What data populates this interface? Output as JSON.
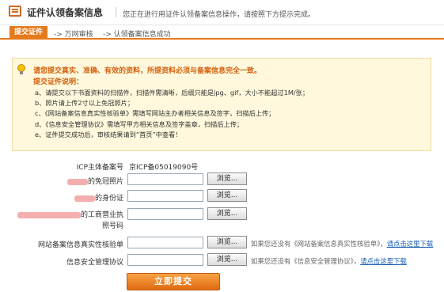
{
  "header": {
    "title": "证件认领备案信息",
    "description": "您正在进行用证件认领备案信息操作，请按照下方提示完成。"
  },
  "steps": [
    {
      "label": "提交证件",
      "active": true
    },
    {
      "label": "-> 万网审核",
      "active": false
    },
    {
      "label": "-> 认领备案信息成功",
      "active": false
    }
  ],
  "notice": {
    "icon": "lightbulb-icon",
    "headline": "请您提交真实、准确、有效的资料，所提资料必须与备案信息完全一致。",
    "subtitle": "提交证件说明：",
    "items": [
      "a、请提交以下书面资料的扫描件，扫描件需清晰，后缀只能是jpg、gif，大小不能超过1M/张；",
      "b、照片请上传2寸以上免冠照片；",
      "c、《网站备案信息真实性核验单》需填写网站主办者相关信息及签字，扫描后上传；",
      "d、《信息安全管理协议》需填写甲方相关信息及签字盖章，扫描后上传；",
      "e、证件提交成功后，审核结果请到“首页”中查看！"
    ]
  },
  "form": {
    "icp_label": "ICP主体备案号",
    "icp_value": "京ICP备05019090号",
    "photo_label_suffix": "的免冠照片",
    "id_label_suffix": "的身份证",
    "license_label_suffix": "的工商营业执",
    "license_label_line2": "照号码",
    "verify_label": "网站备案信息真实性核验单",
    "security_label": "信息安全管理协议",
    "browse_label": "浏览...",
    "verify_hint": "如果您还没有《网站备案信息真实性核验单》，",
    "verify_link": "请点击这里下载",
    "security_hint": "如果您还没有《信息安全管理协议》，",
    "security_link": "请点击这里下载",
    "submit_label": "立即提交"
  },
  "colors": {
    "accent": "#e57a1c",
    "notice_text": "#d3610d",
    "notice_bg": "#fff8dc",
    "link": "#1a5fb4"
  }
}
